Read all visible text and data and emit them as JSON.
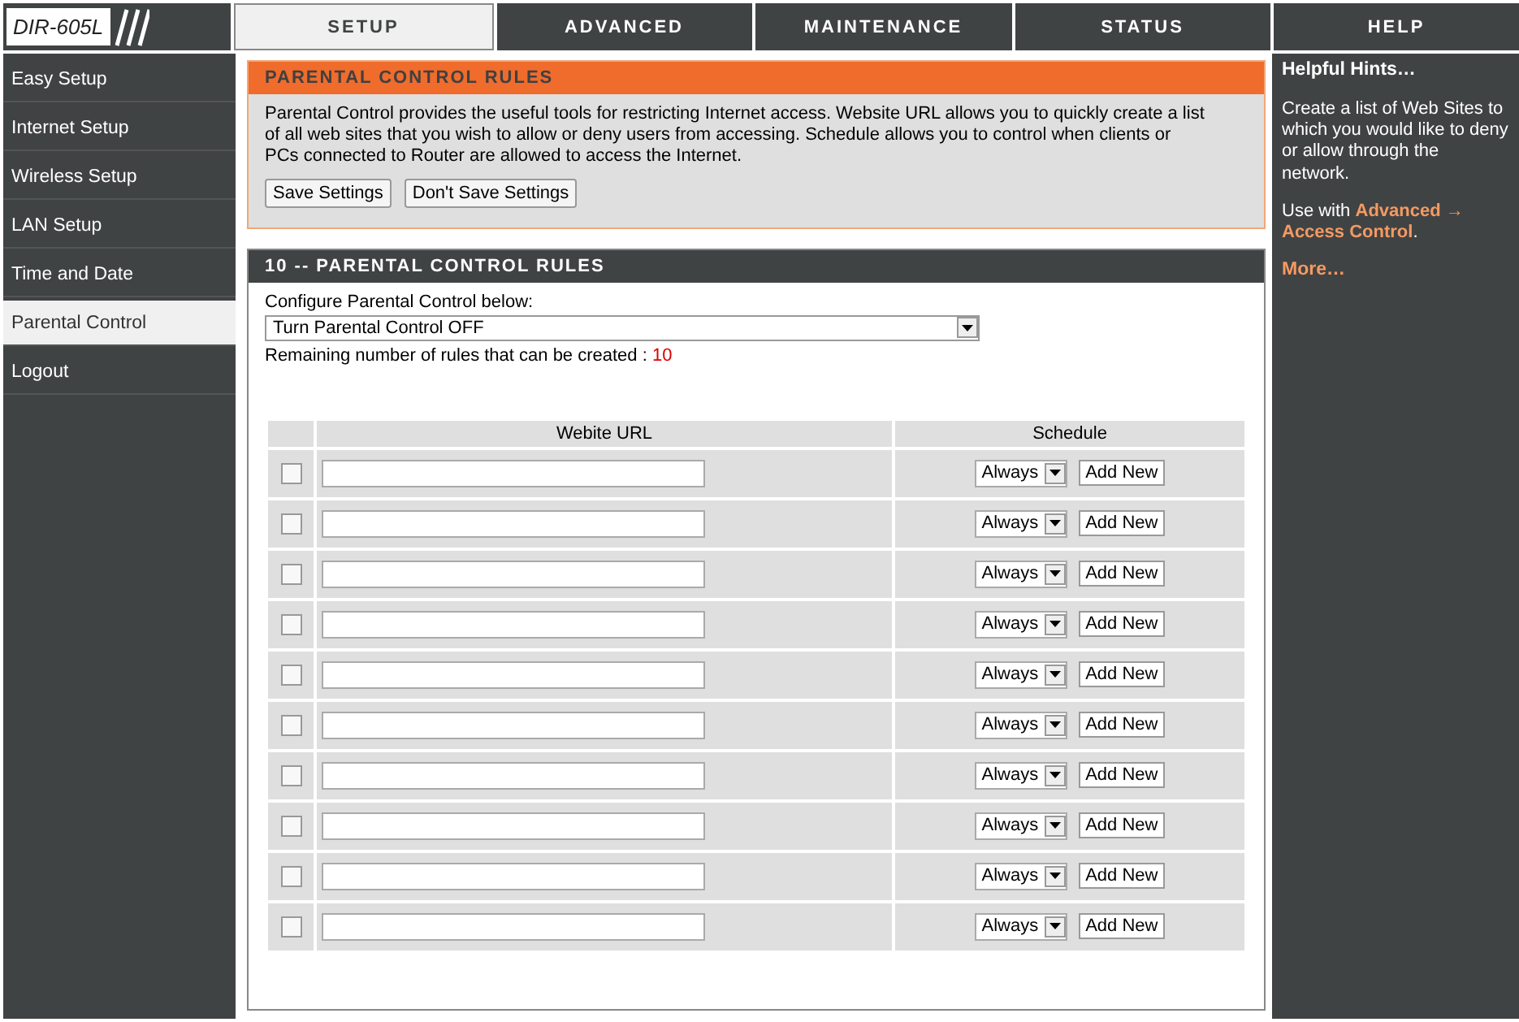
{
  "logo": {
    "model": "DIR-605L"
  },
  "tabs": [
    {
      "label": "SETUP",
      "selected": true
    },
    {
      "label": "ADVANCED",
      "selected": false
    },
    {
      "label": "MAINTENANCE",
      "selected": false
    },
    {
      "label": "STATUS",
      "selected": false
    },
    {
      "label": "HELP",
      "selected": false
    }
  ],
  "sidebar": {
    "items": [
      {
        "label": "Easy Setup",
        "selected": false
      },
      {
        "label": "Internet Setup",
        "selected": false
      },
      {
        "label": "Wireless Setup",
        "selected": false
      },
      {
        "label": "LAN Setup",
        "selected": false
      },
      {
        "label": "Time and Date",
        "selected": false
      },
      {
        "label": "Parental Control",
        "selected": true
      },
      {
        "label": "Logout",
        "selected": false
      }
    ]
  },
  "intro": {
    "title": "PARENTAL CONTROL RULES",
    "text": "Parental Control provides the useful tools for restricting Internet access. Website URL allows you to quickly create a list of all web sites that you wish to allow or deny users from accessing. Schedule allows you to control when clients or PCs connected to Router are allowed to access the Internet.",
    "buttons": [
      "Save Settings",
      "Don't Save Settings"
    ]
  },
  "rules": {
    "title": "10 -- PARENTAL CONTROL RULES",
    "configure_label": "Configure Parental Control below:",
    "mode": "Turn Parental Control OFF",
    "remaining_label": "Remaining number of rules that can be created :",
    "remaining_count": "10",
    "columns": [
      "Webite URL",
      "Schedule"
    ],
    "rows": [
      {
        "checked": false,
        "schedule": "Always",
        "button": "Add New"
      },
      {
        "checked": false,
        "schedule": "Always",
        "button": "Add New"
      },
      {
        "checked": false,
        "schedule": "Always",
        "button": "Add New"
      },
      {
        "checked": false,
        "schedule": "Always",
        "button": "Add New"
      },
      {
        "checked": false,
        "schedule": "Always",
        "button": "Add New"
      },
      {
        "checked": false,
        "schedule": "Always",
        "button": "Add New"
      },
      {
        "checked": false,
        "schedule": "Always",
        "button": "Add New"
      },
      {
        "checked": false,
        "schedule": "Always",
        "button": "Add New"
      },
      {
        "checked": false,
        "schedule": "Always",
        "button": "Add New"
      },
      {
        "checked": false,
        "schedule": "Always",
        "button": "Add New"
      }
    ]
  },
  "help": {
    "title": "Helpful Hints…",
    "text": "Create a list of Web Sites to which you would like to deny or allow through the network.",
    "use_with": "Use with",
    "link": [
      "Advanced →",
      "Access Control"
    ],
    "link_end": ".",
    "more": "More…"
  }
}
